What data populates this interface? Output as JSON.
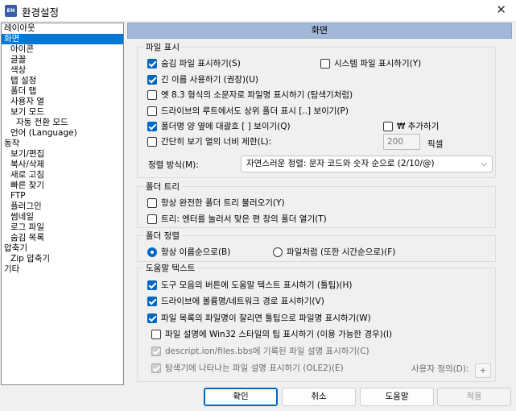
{
  "window": {
    "title": "환경설정",
    "app_icon_text": "EN"
  },
  "tree": [
    {
      "label": "레이아웃"
    },
    {
      "label": "화면",
      "selected": true
    },
    {
      "label": "아이콘"
    },
    {
      "label": "글꼴"
    },
    {
      "label": "색상"
    },
    {
      "label": "탭 설정"
    },
    {
      "label": "폴더 탭"
    },
    {
      "label": "사용자 열"
    },
    {
      "label": "보기 모드"
    },
    {
      "label": "자동 전환 모드"
    },
    {
      "label": "언어 (Language)"
    },
    {
      "label": "동작"
    },
    {
      "label": "보기/편집"
    },
    {
      "label": "복사/삭제"
    },
    {
      "label": "새로 고침"
    },
    {
      "label": "빠른 찾기"
    },
    {
      "label": "FTP"
    },
    {
      "label": "플러그인"
    },
    {
      "label": "썸네일"
    },
    {
      "label": "로그 파일"
    },
    {
      "label": "숨김 목록"
    },
    {
      "label": "압축기"
    },
    {
      "label": "Zip 압축기"
    },
    {
      "label": "기타"
    }
  ],
  "header": "화면",
  "file_display": {
    "group_label": "파일 표시",
    "show_hidden": {
      "label": "숨김 파일 표시하기(S)",
      "checked": true
    },
    "show_system": {
      "label": "시스템 파일 표시하기(Y)",
      "checked": false
    },
    "long_names": {
      "label": "긴 이름 사용하기 (권장)(U)",
      "checked": true
    },
    "lowercase_83": {
      "label": "옛 8.3 형식의 소문자로 파일명 표시하기 (탐색기처럼)",
      "checked": false
    },
    "root_parent": {
      "label": "드라이브의 루트에서도 상위 폴더 표시 [..] 보이기(P)",
      "checked": false
    },
    "brackets": {
      "label": "폴더명 양 옆에 대괄호 [ ] 보이기(Q)",
      "checked": true
    },
    "add_won": {
      "label": "₩ 추가하기",
      "checked": false
    },
    "limit_width": {
      "label": "간단히 보기 열의 너비 제한(L):",
      "checked": false
    },
    "width_value": "200",
    "width_unit": "픽셀",
    "sort_label": "정렬 방식(M):",
    "sort_value": "자연스러운 정렬: 문자 코드와 숫자 순으로 (2/10/@)"
  },
  "folder_tree": {
    "group_label": "폴더 트리",
    "expand_full": {
      "label": "항상 완전한 폴더 트리 불러오기(Y)",
      "checked": false
    },
    "enter_open": {
      "label": "트리: 엔터를 눌러서 맞은 편 창의 폴더 열기(T)",
      "checked": false
    }
  },
  "folder_sort": {
    "group_label": "폴더 정렬",
    "by_name": {
      "label": "항상 이름순으로(B)",
      "selected": true
    },
    "like_files": {
      "label": "파일처럼 (또한 시간순으로)(F)",
      "selected": false
    }
  },
  "tooltips": {
    "group_label": "도움말 텍스트",
    "toolbar_tips": {
      "label": "도구 모음의 버튼에 도움말 텍스트 표시하기 (툴팁)(H)",
      "checked": true
    },
    "drive_volume": {
      "label": "드라이브에 볼륨명/네트워크 경로 표시하기(V)",
      "checked": true
    },
    "truncated_names": {
      "label": "파일 목록의 파일명이 잘리면 툴팁으로 파일명 표시하기(W)",
      "checked": true
    },
    "win32_tips": {
      "label": "파일 설명에 Win32 스타일의 팁 표시하기 (이용 가능한 경우)(I)",
      "checked": false
    },
    "descript_ion": {
      "label": "descript.ion/files.bbs에 기록된 파일 설명 표시하기(C)",
      "checked": true,
      "disabled": true
    },
    "explorer_ole2": {
      "label": "탐색기에 나타나는 파일 설명 표시하기 (OLE2)(E)",
      "checked": true,
      "disabled": true
    },
    "custom_label": "사용자 정의(D):",
    "custom_button": "+"
  },
  "buttons": {
    "ok": "확인",
    "cancel": "취소",
    "help": "도움말",
    "apply": "적용"
  }
}
